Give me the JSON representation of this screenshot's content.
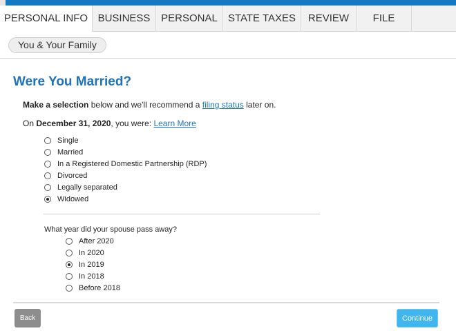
{
  "tabs": [
    {
      "label": "PERSONAL INFO",
      "active": true
    },
    {
      "label": "BUSINESS",
      "active": false
    },
    {
      "label": "PERSONAL",
      "active": false
    },
    {
      "label": "STATE TAXES",
      "active": false
    },
    {
      "label": "REVIEW",
      "active": false
    },
    {
      "label": "FILE",
      "active": false
    }
  ],
  "subtab": {
    "label": "You & Your Family"
  },
  "page": {
    "title": "Were You Married?"
  },
  "intro": {
    "bold": "Make a selection",
    "text_before_link": " below and we'll recommend a ",
    "link": "filing status",
    "text_after_link": " later on."
  },
  "date_line": {
    "prefix": "On ",
    "bold": "December 31, 2020",
    "suffix": ", you were: ",
    "link": "Learn More"
  },
  "marital_options": [
    {
      "label": "Single",
      "checked": false
    },
    {
      "label": "Married",
      "checked": false
    },
    {
      "label": "In a Registered Domestic Partnership (RDP)",
      "checked": false
    },
    {
      "label": "Divorced",
      "checked": false
    },
    {
      "label": "Legally separated",
      "checked": false
    },
    {
      "label": "Widowed",
      "checked": true
    }
  ],
  "spouse_question": {
    "label": "What year did your spouse pass away?"
  },
  "year_options": [
    {
      "label": "After 2020",
      "checked": false
    },
    {
      "label": "In 2020",
      "checked": false
    },
    {
      "label": "In 2019",
      "checked": true
    },
    {
      "label": "In 2018",
      "checked": false
    },
    {
      "label": "Before 2018",
      "checked": false
    }
  ],
  "buttons": {
    "back": "Back",
    "continue": "Continue"
  },
  "colors": {
    "accent": "#1478c2",
    "title": "#1f72b8",
    "link": "#1a73c9",
    "continue": "#3fb6ee",
    "back": "#8d8d8d"
  }
}
